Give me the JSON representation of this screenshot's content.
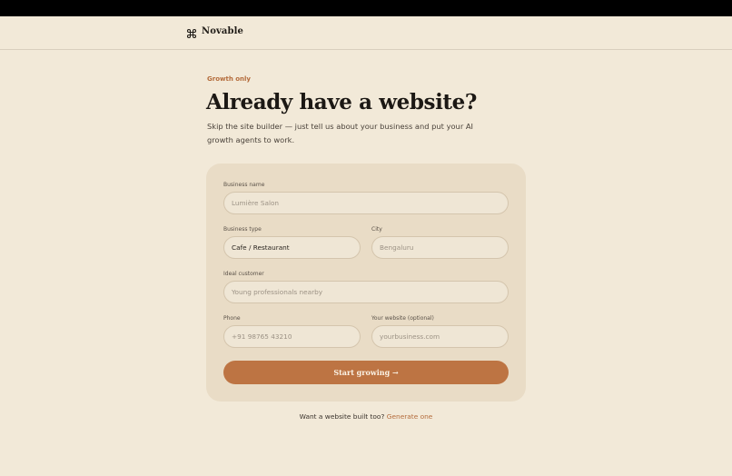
{
  "brand": {
    "name": "Novable",
    "icon": "command-icon"
  },
  "hero": {
    "eyebrow": "Growth only",
    "title": "Already have a website?",
    "subtitle": "Skip the site builder — just tell us about your business and put your AI growth agents to work."
  },
  "form": {
    "business_name": {
      "label": "Business name",
      "placeholder": "Lumière Salon",
      "value": ""
    },
    "business_type": {
      "label": "Business type",
      "value": "Cafe / Restaurant"
    },
    "city": {
      "label": "City",
      "placeholder": "Bengaluru",
      "value": ""
    },
    "ideal_customer": {
      "label": "Ideal customer",
      "placeholder": "Young professionals nearby",
      "value": ""
    },
    "phone": {
      "label": "Phone",
      "placeholder": "+91 98765 43210",
      "value": ""
    },
    "website": {
      "label": "Your website (optional)",
      "placeholder": "yourbusiness.com",
      "value": ""
    },
    "submit_label": "Start growing →"
  },
  "footer": {
    "prompt": "Want a website built too?",
    "link_label": "Generate one"
  },
  "colors": {
    "background": "#f2e9d8",
    "card": "#e9dcc6",
    "accent": "#bd7443",
    "eyebrow": "#b46c3c",
    "headline": "#1c1814"
  }
}
